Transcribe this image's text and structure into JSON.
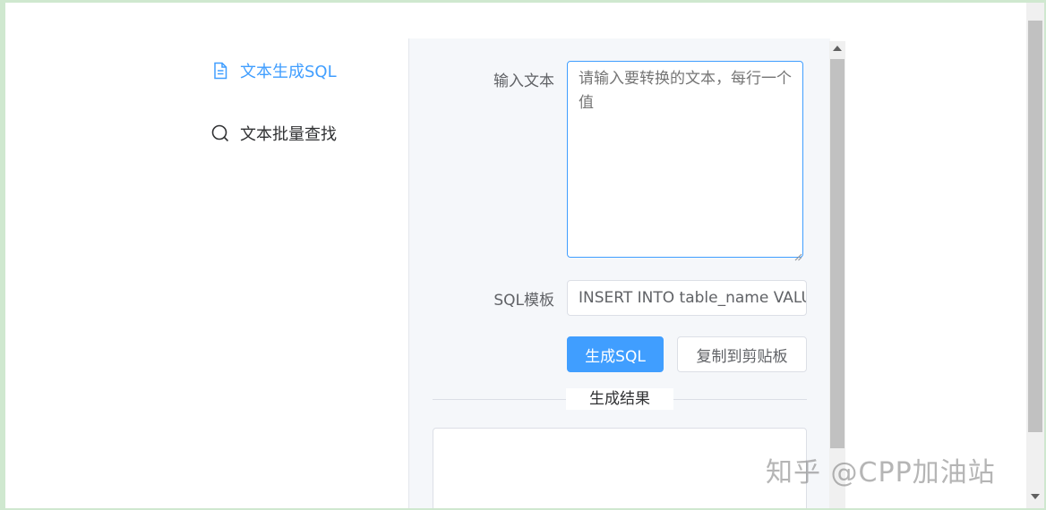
{
  "sidebar": {
    "items": [
      {
        "label": "文本生成SQL",
        "icon": "document-icon",
        "active": true
      },
      {
        "label": "文本批量查找",
        "icon": "search-icon",
        "active": false
      }
    ]
  },
  "form": {
    "input_label": "输入文本",
    "input_placeholder": "请输入要转换的文本，每行一个值",
    "sql_label": "SQL模板",
    "sql_value": "INSERT INTO table_name VALUES",
    "generate_button": "生成SQL",
    "copy_button": "复制到剪贴板",
    "result_divider": "生成结果"
  },
  "watermark": "知乎 @CPP加油站",
  "colors": {
    "accent": "#409eff",
    "text": "#303133",
    "muted": "#606266",
    "placeholder": "#a8abb2"
  }
}
